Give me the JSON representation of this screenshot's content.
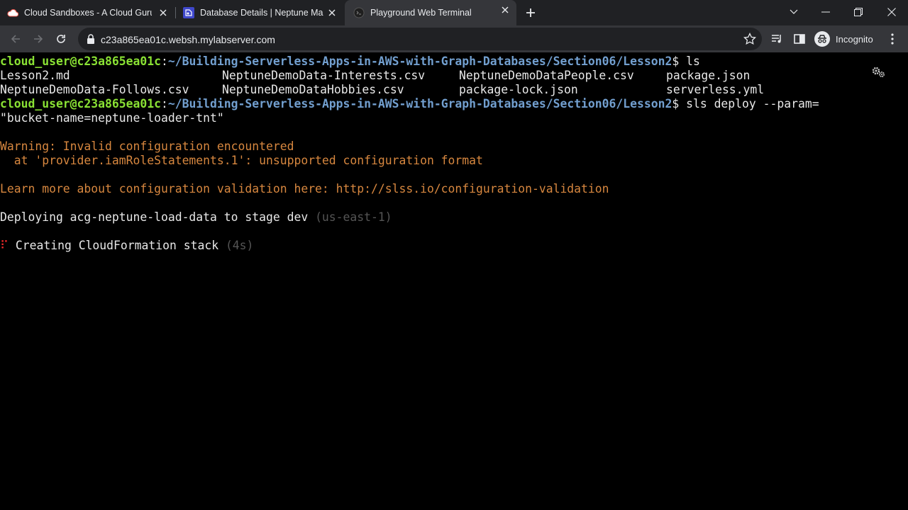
{
  "browser": {
    "tabs": [
      {
        "title": "Cloud Sandboxes - A Cloud Guru",
        "icon": "cloud-icon",
        "active": false
      },
      {
        "title": "Database Details | Neptune Mana",
        "icon": "neptune-icon",
        "active": false
      },
      {
        "title": "Playground Web Terminal",
        "icon": "terminal-globe-icon",
        "active": true
      }
    ],
    "url": "c23a865ea01c.websh.mylabserver.com",
    "profile_label": "Incognito"
  },
  "terminal": {
    "prompt_user": "cloud_user@c23a865ea01c",
    "prompt_sep": ":",
    "prompt_path": "~/Building-Serverless-Apps-in-AWS-with-Graph-Databases/Section06/Lesson2",
    "prompt_suffix": "$ ",
    "cmd1": "ls",
    "ls_row1": [
      "Lesson2.md",
      "NeptuneDemoData-Interests.csv",
      "NeptuneDemoDataPeople.csv",
      "package.json"
    ],
    "ls_row2": [
      "NeptuneDemoData-Follows.csv",
      "NeptuneDemoDataHobbies.csv",
      "package-lock.json",
      "serverless.yml"
    ],
    "cmd2_part1": "sls deploy --param=",
    "cmd2_part2": "\"bucket-name=neptune-loader-tnt\"",
    "warning_line1": "Warning: Invalid configuration encountered",
    "warning_line2": "  at 'provider.iamRoleStatements.1': unsupported configuration format",
    "learn_more": "Learn more about configuration validation here: http://slss.io/configuration-validation",
    "deploying": "Deploying acg-neptune-load-data to stage dev ",
    "deploying_region": "(us-east-1)",
    "spinner_glyph": "⠏",
    "creating": " Creating CloudFormation stack ",
    "creating_time": "(4s)"
  },
  "colors": {
    "prompt_user": "#8ae234",
    "prompt_path": "#729fcf",
    "warning": "#d7873f",
    "dim": "#555555",
    "spinner": "#ef2929"
  }
}
